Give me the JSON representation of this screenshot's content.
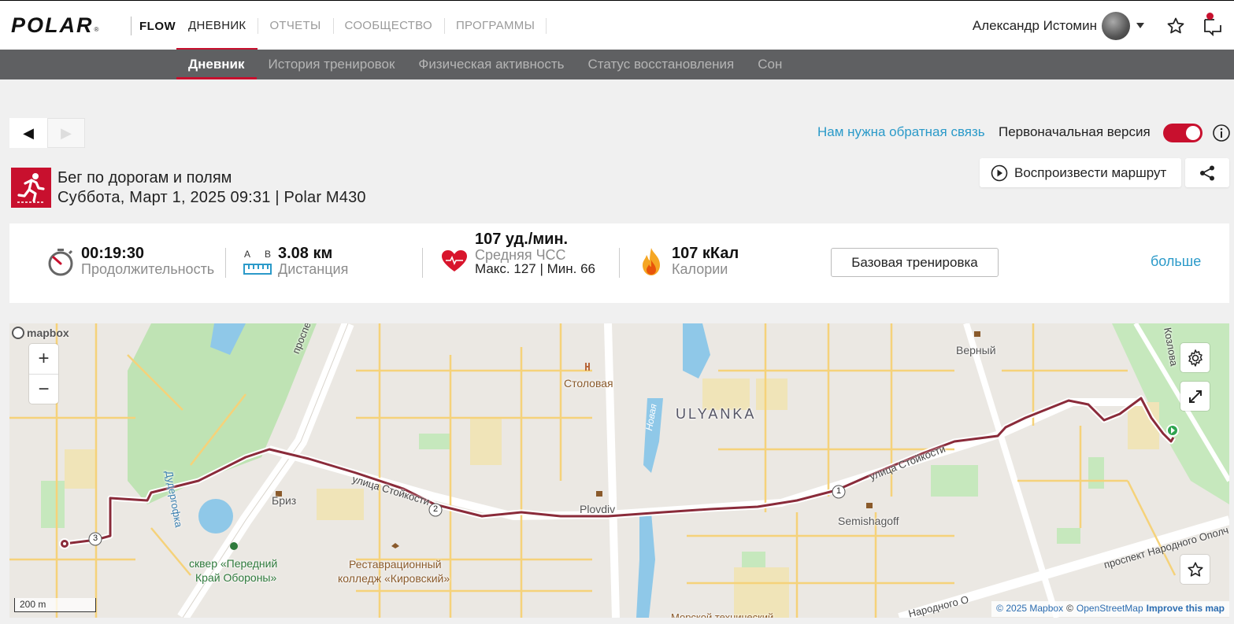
{
  "header": {
    "logo": "POLAR",
    "logo_reg": "®",
    "product": "FLOW",
    "nav": [
      "ДНЕВНИК",
      "ОТЧЕТЫ",
      "СООБЩЕСТВО",
      "ПРОГРАММЫ"
    ],
    "active_nav": "ДНЕВНИК",
    "user_name": "Александр Истомин"
  },
  "subnav": {
    "items": [
      "Дневник",
      "История тренировок",
      "Физическая активность",
      "Статус восстановления",
      "Сон"
    ],
    "active": "Дневник"
  },
  "controls": {
    "prev": "◀",
    "next": "▶",
    "feedback_link": "Нам нужна обратная связь",
    "original_version_label": "Первоначальная версия",
    "original_version_on": true
  },
  "session": {
    "title": "Бег по дорогам и полям",
    "subtitle": "Суббота, Март 1, 2025 09:31 | Polar M430",
    "play_route_label": "Воспроизвести маршрут"
  },
  "stats": {
    "duration_value": "00:19:30",
    "duration_label": "Продолжительность",
    "distance_a": "A",
    "distance_b": "B",
    "distance_value": "3.08 км",
    "distance_label": "Дистанция",
    "hr_value": "107 уд./мин.",
    "hr_label": "Средняя ЧСС",
    "hr_minmax": "Макс. 127  |  Мин. 66",
    "calories_value": "107 кКал",
    "calories_label": "Калории",
    "training_type_button": "Базовая тренировка",
    "more_link": "больше"
  },
  "map": {
    "provider_logo": "mapbox",
    "zoom_in": "+",
    "zoom_out": "−",
    "scale": "200 m",
    "attribution": [
      "© 2025 Mapbox",
      "©",
      "OpenStreetMap",
      "Improve this map"
    ],
    "labels": {
      "prospekt_m": "проспект Ма",
      "stolovaya": "Столовая",
      "ulyanka": "ULYANKA",
      "verny": "Верный",
      "novaya": "Новая",
      "dudergofka": "Дудергофка",
      "briz": "Бриз",
      "ulitsa_stoykosti_1": "улица Стойкости",
      "ulitsa_stoykosti_2": "улица Стойкости",
      "plovdiv": "Plovdiv",
      "semishagoff": "Semishagoff",
      "skver_1": "сквер «Передний",
      "skver_2": "Край Обороны»",
      "college_1": "Реставрационный",
      "college_2": "колледж «Кировский»",
      "prospekt_np": "проспект Народного Ополч",
      "narodnogo": "Народного О",
      "kozlova": "Козлова",
      "morskoy": "Морской технический"
    },
    "km_markers": [
      "1",
      "2",
      "3"
    ]
  },
  "colors": {
    "accent": "#c8102e",
    "link": "#2b9ac9",
    "route": "#8a2b3a"
  }
}
